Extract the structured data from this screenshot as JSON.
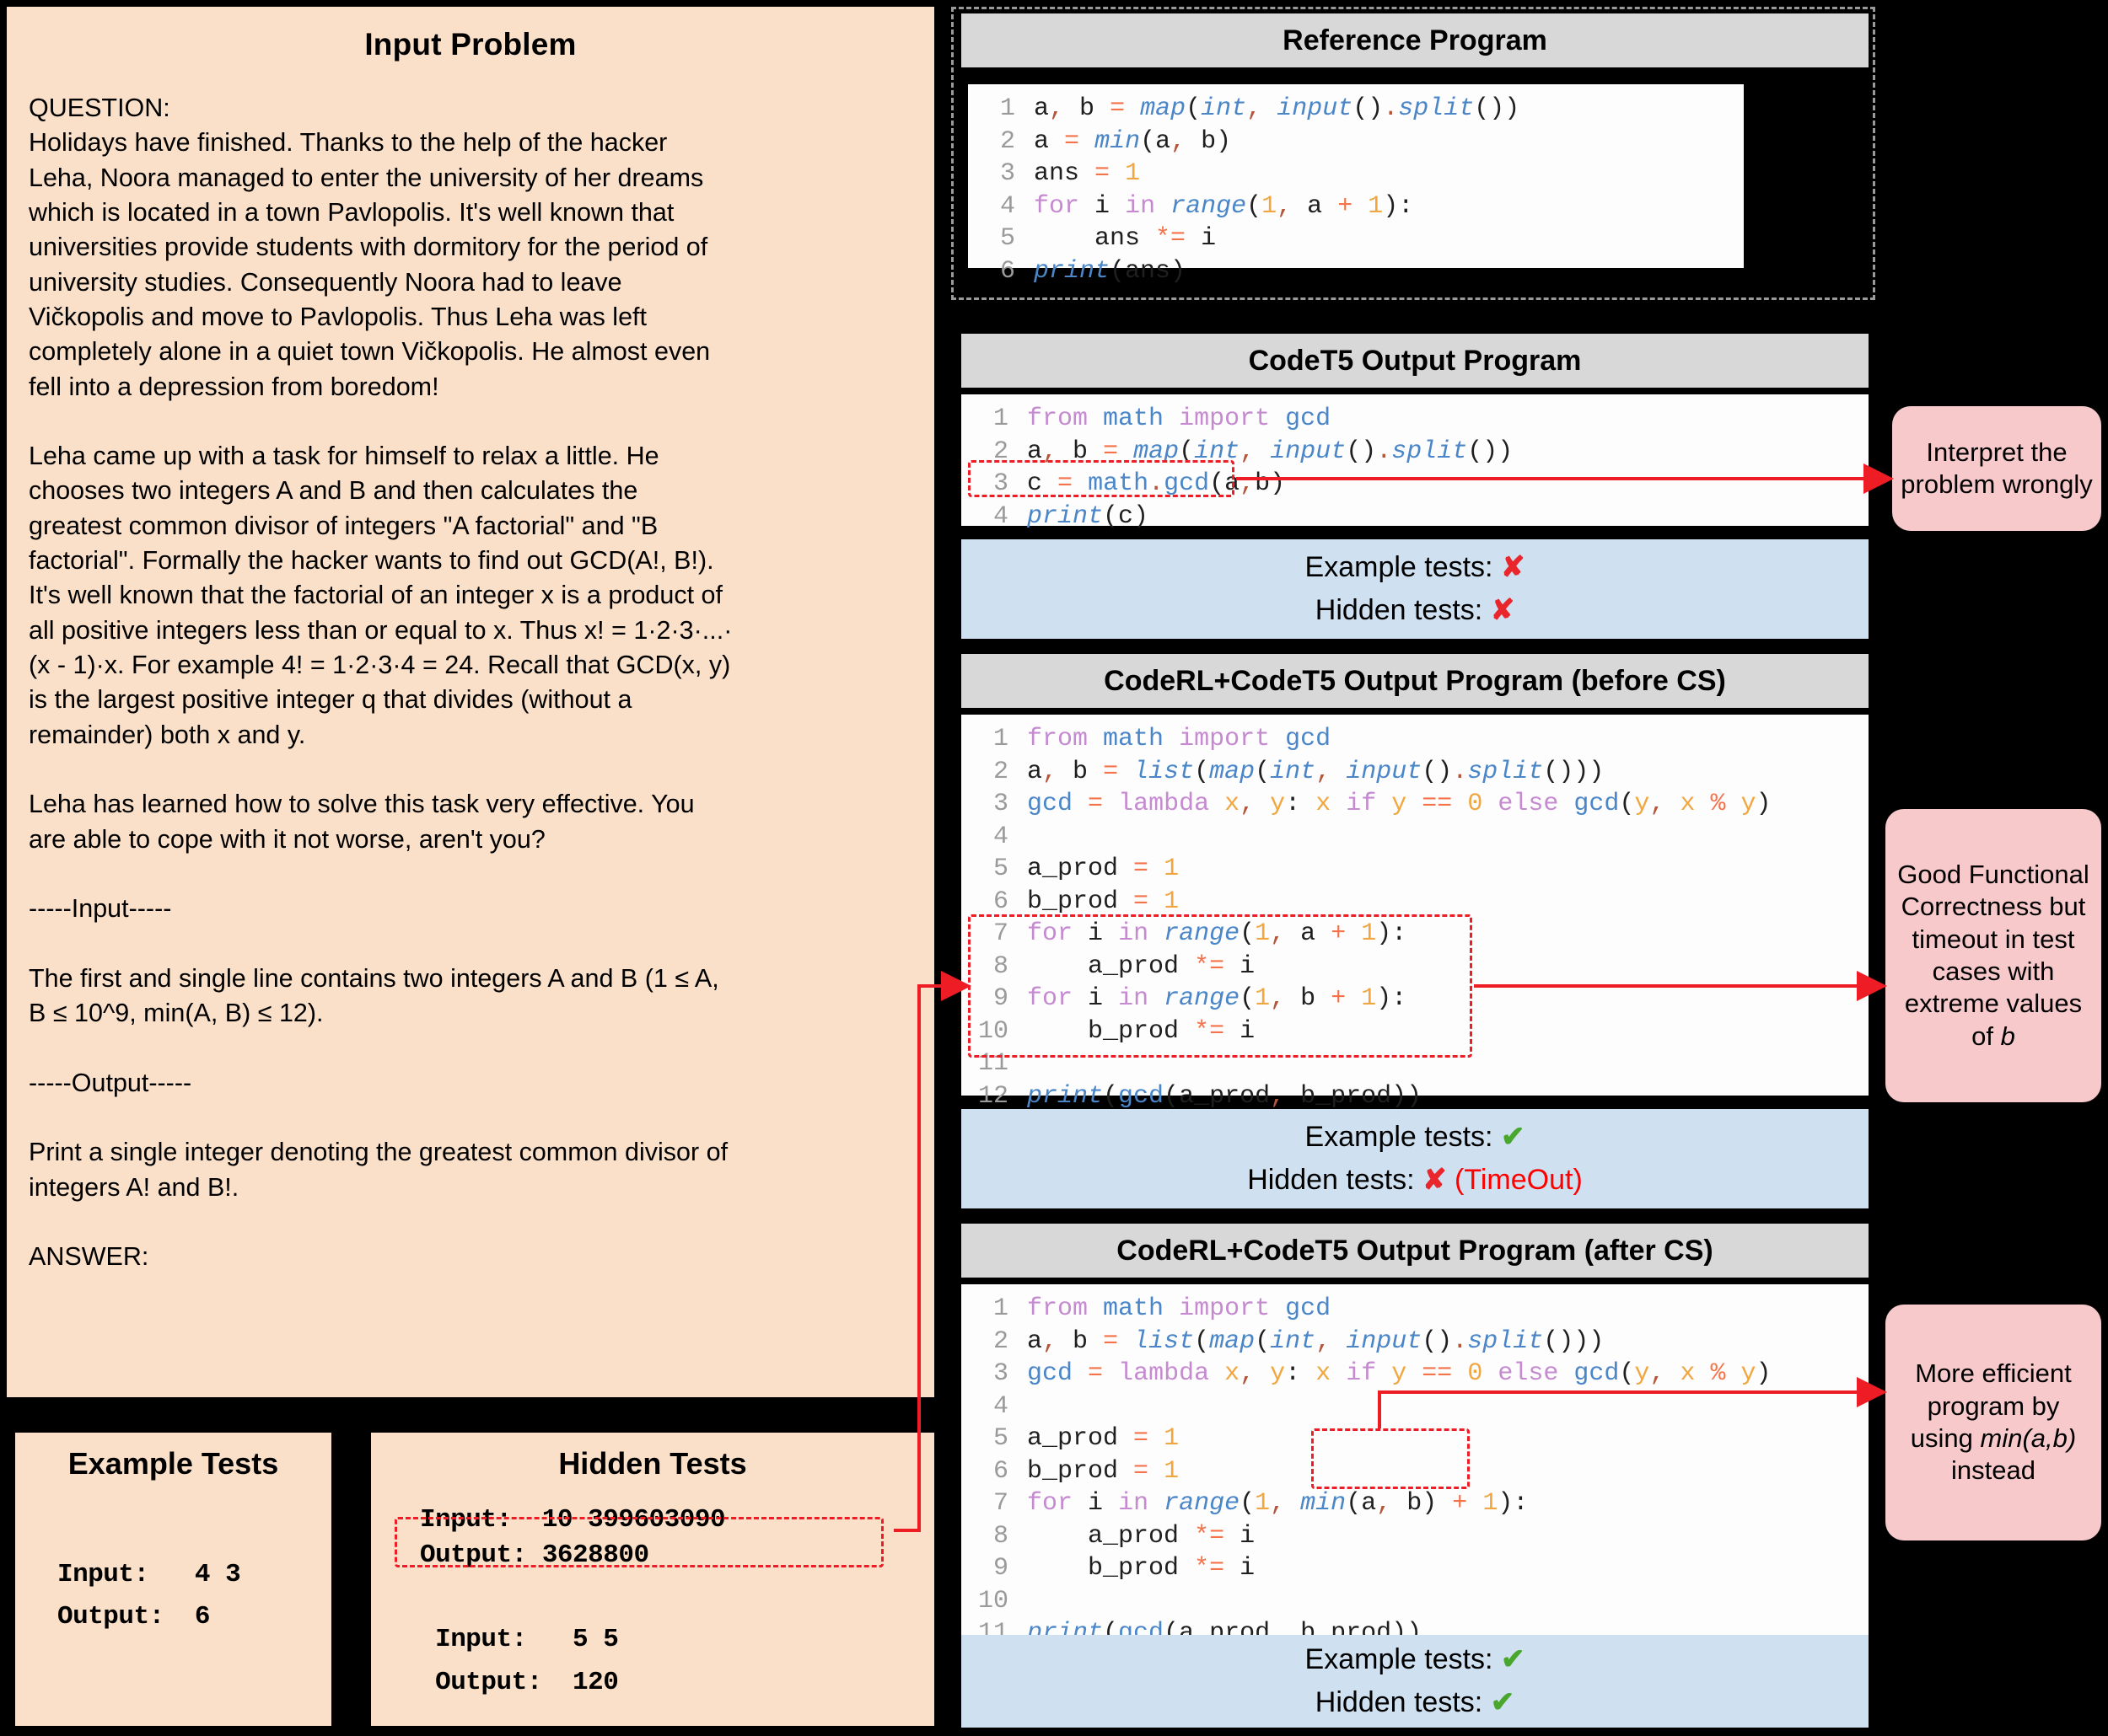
{
  "problem": {
    "title": "Input Problem",
    "body": "QUESTION:\nHolidays have finished. Thanks to the help of the hacker\nLeha, Noora managed to enter the university of her dreams\nwhich is located in a town Pavlopolis. It's well known that\nuniversities provide students with dormitory for the period of\nuniversity studies. Consequently Noora had to leave\nVičkopolis and move to Pavlopolis. Thus Leha was left\ncompletely alone in a quiet town Vičkopolis. He almost even\nfell into a depression from boredom!\n\nLeha came up with a task for himself to relax a little. He\nchooses two integers A and B and then calculates the\ngreatest common divisor of integers \"A factorial\" and \"B\nfactorial\". Formally the hacker wants to find out GCD(A!, B!).\nIt's well known that the factorial of an integer x is a product of\nall positive integers less than or equal to x. Thus x! = 1·2·3·...·\n(x - 1)·x. For example 4! = 1·2·3·4 = 24. Recall that GCD(x, y)\nis the largest positive integer q that divides (without a\nremainder) both x and y.\n\nLeha has learned how to solve this task very effective. You\nare able to cope with it not worse, aren't you?\n\n-----Input-----\n\nThe first and single line contains two integers A and B (1 ≤ A,\nB ≤ 10^9, min(A, B) ≤ 12).\n\n-----Output-----\n\nPrint a single integer denoting the greatest common divisor of\nintegers A! and B!.\n\nANSWER:"
  },
  "example_tests": {
    "title": "Example Tests",
    "lines": "Input:   4 3\nOutput:  6"
  },
  "hidden_tests": {
    "title": "Hidden Tests",
    "line_highlighted": "Input:  10 399603090",
    "lines_rest": "Output: 3628800\n\n Input:   5 5\n Output:  120"
  },
  "reference_program": {
    "title": "Reference Program",
    "lines": [
      {
        "n": "1",
        "code": "a, b = map(int, input().split())"
      },
      {
        "n": "2",
        "code": "a = min(a, b)"
      },
      {
        "n": "3",
        "code": "ans = 1"
      },
      {
        "n": "4",
        "code": "for i in range(1, a + 1):"
      },
      {
        "n": "5",
        "code": "    ans *= i"
      },
      {
        "n": "6",
        "code": "print(ans)"
      }
    ]
  },
  "codet5": {
    "title": "CodeT5 Output Program",
    "lines": [
      {
        "n": "1",
        "code": "from math import gcd"
      },
      {
        "n": "2",
        "code": "a, b = map(int, input().split())"
      },
      {
        "n": "3",
        "code": "c = math.gcd(a,b)"
      },
      {
        "n": "4",
        "code": "print(c)"
      }
    ],
    "results": {
      "example_label": "Example tests:",
      "example_mark": "✘",
      "hidden_label": "Hidden tests:",
      "hidden_mark": "✘",
      "hidden_note": ""
    },
    "annotation": "Interpret the problem wrongly"
  },
  "before_cs": {
    "title": "CodeRL+CodeT5 Output Program (before CS)",
    "lines": [
      {
        "n": "1",
        "code": "from math import gcd"
      },
      {
        "n": "2",
        "code": "a, b = list(map(int, input().split()))"
      },
      {
        "n": "3",
        "code": "gcd = lambda x, y: x if y == 0 else gcd(y, x % y)"
      },
      {
        "n": "4",
        "code": ""
      },
      {
        "n": "5",
        "code": "a_prod = 1"
      },
      {
        "n": "6",
        "code": "b_prod = 1"
      },
      {
        "n": "7",
        "code": "for i in range(1, a + 1):"
      },
      {
        "n": "8",
        "code": "    a_prod *= i"
      },
      {
        "n": "9",
        "code": "for i in range(1, b + 1):"
      },
      {
        "n": "10",
        "code": "    b_prod *= i"
      },
      {
        "n": "11",
        "code": ""
      },
      {
        "n": "12",
        "code": "print(gcd(a_prod, b_prod))"
      }
    ],
    "results": {
      "example_label": "Example tests:",
      "example_mark": "✔",
      "hidden_label": "Hidden tests:",
      "hidden_mark": "✘",
      "hidden_note": "(TimeOut)"
    },
    "annotation_plain_1": "Good Functional Correctness but timeout in test cases with extreme values of ",
    "annotation_italic_1": "b"
  },
  "after_cs": {
    "title": "CodeRL+CodeT5 Output Program (after CS)",
    "lines": [
      {
        "n": "1",
        "code": "from math import gcd"
      },
      {
        "n": "2",
        "code": "a, b = list(map(int, input().split()))"
      },
      {
        "n": "3",
        "code": "gcd = lambda x, y: x if y == 0 else gcd(y, x % y)"
      },
      {
        "n": "4",
        "code": ""
      },
      {
        "n": "5",
        "code": "a_prod = 1"
      },
      {
        "n": "6",
        "code": "b_prod = 1"
      },
      {
        "n": "7",
        "code": "for i in range(1, min(a, b) + 1):"
      },
      {
        "n": "8",
        "code": "    a_prod *= i"
      },
      {
        "n": "9",
        "code": "    b_prod *= i"
      },
      {
        "n": "10",
        "code": ""
      },
      {
        "n": "11",
        "code": "print(gcd(a_prod, b_prod))"
      }
    ],
    "results": {
      "example_label": "Example tests:",
      "example_mark": "✔",
      "hidden_label": "Hidden tests:",
      "hidden_mark": "✔",
      "hidden_note": ""
    },
    "annotation_plain_1": "More efficient program by using ",
    "annotation_italic_1": "min(a,b)",
    "annotation_plain_2": " instead"
  },
  "colors": {
    "peach": "#fae0c8",
    "header_gray": "#d8d8d8",
    "result_blue": "#cfe0f0",
    "bubble_pink": "#f7c9cb",
    "highlight_red": "#ee1c25",
    "tick_green": "#4aa72e",
    "cross_red": "#e8262b"
  }
}
